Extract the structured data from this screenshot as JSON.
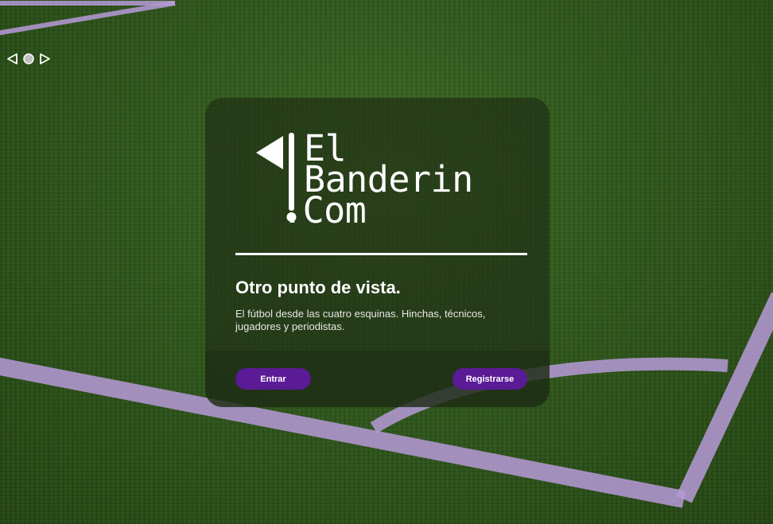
{
  "brand": {
    "line1": "El",
    "line2": "Banderin",
    "line3": ".Com"
  },
  "hero": {
    "headline": "Otro punto de vista.",
    "description": "El fútbol desde las cuatro esquinas. Hinchas, técnicos, jugadores y periodistas."
  },
  "actions": {
    "login_label": "Entrar",
    "register_label": "Registrarse"
  },
  "carousel": {
    "controls": [
      "prev-icon",
      "dot-icon",
      "next-icon"
    ]
  },
  "colors": {
    "accent": "#5b1a96",
    "field_lines": "#b79ad8",
    "grass": "#2f571b"
  }
}
